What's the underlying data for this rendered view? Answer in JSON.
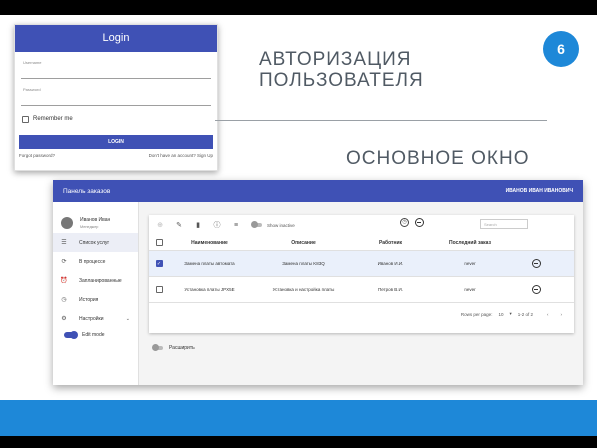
{
  "slide": {
    "title_line1": "АВТОРИЗАЦИЯ",
    "title_line2": "ПОЛЬЗОВАТЕЛЯ",
    "page_number": "6",
    "subtitle": "ОСНОВНОЕ ОКНО",
    "accent_color": "#1e88d8"
  },
  "login": {
    "header": "Login",
    "username_placeholder": "Username",
    "password_placeholder": "Password",
    "remember_label": "Remember me",
    "button_label": "LOGIN",
    "forgot_link": "Forgot password?",
    "signup_link": "Don't have an account? Sign Up",
    "brand_color": "#3f51b5"
  },
  "app": {
    "title": "Панель заказов",
    "user_name_upper": "ИВАНОВ ИВАН ИВАНОВИЧ",
    "profile": {
      "name": "Иванов Иван",
      "role": "Менеджер"
    },
    "nav": [
      {
        "label": "Список услуг",
        "icon": "list-icon"
      },
      {
        "label": "В процессе",
        "icon": "sync-icon"
      },
      {
        "label": "Запланированные",
        "icon": "alarm-icon"
      },
      {
        "label": "История",
        "icon": "history-icon"
      },
      {
        "label": "Настройки",
        "icon": "gear-icon"
      }
    ],
    "edit_mode_label": "Edit mode",
    "toolbar": {
      "show_inactive": "Show inactive",
      "search_placeholder": "Search"
    },
    "table": {
      "columns": [
        "Наименование",
        "Описание",
        "Работник",
        "Последний заказ"
      ],
      "rows": [
        {
          "name": "Замена платы автомата",
          "description": "Замена платы K83Q",
          "worker": "Иванов И.И.",
          "last_order": "never",
          "checked": true
        },
        {
          "name": "Установка платы JPX5E",
          "description": "Установка и настройка платы",
          "worker": "Петров В.И.",
          "last_order": "never",
          "checked": false
        }
      ]
    },
    "pagination": {
      "rows_per_page_label": "Rows per page:",
      "rows_per_page_value": "10",
      "range": "1-2 of 2"
    },
    "expand_label": "Расширить"
  }
}
